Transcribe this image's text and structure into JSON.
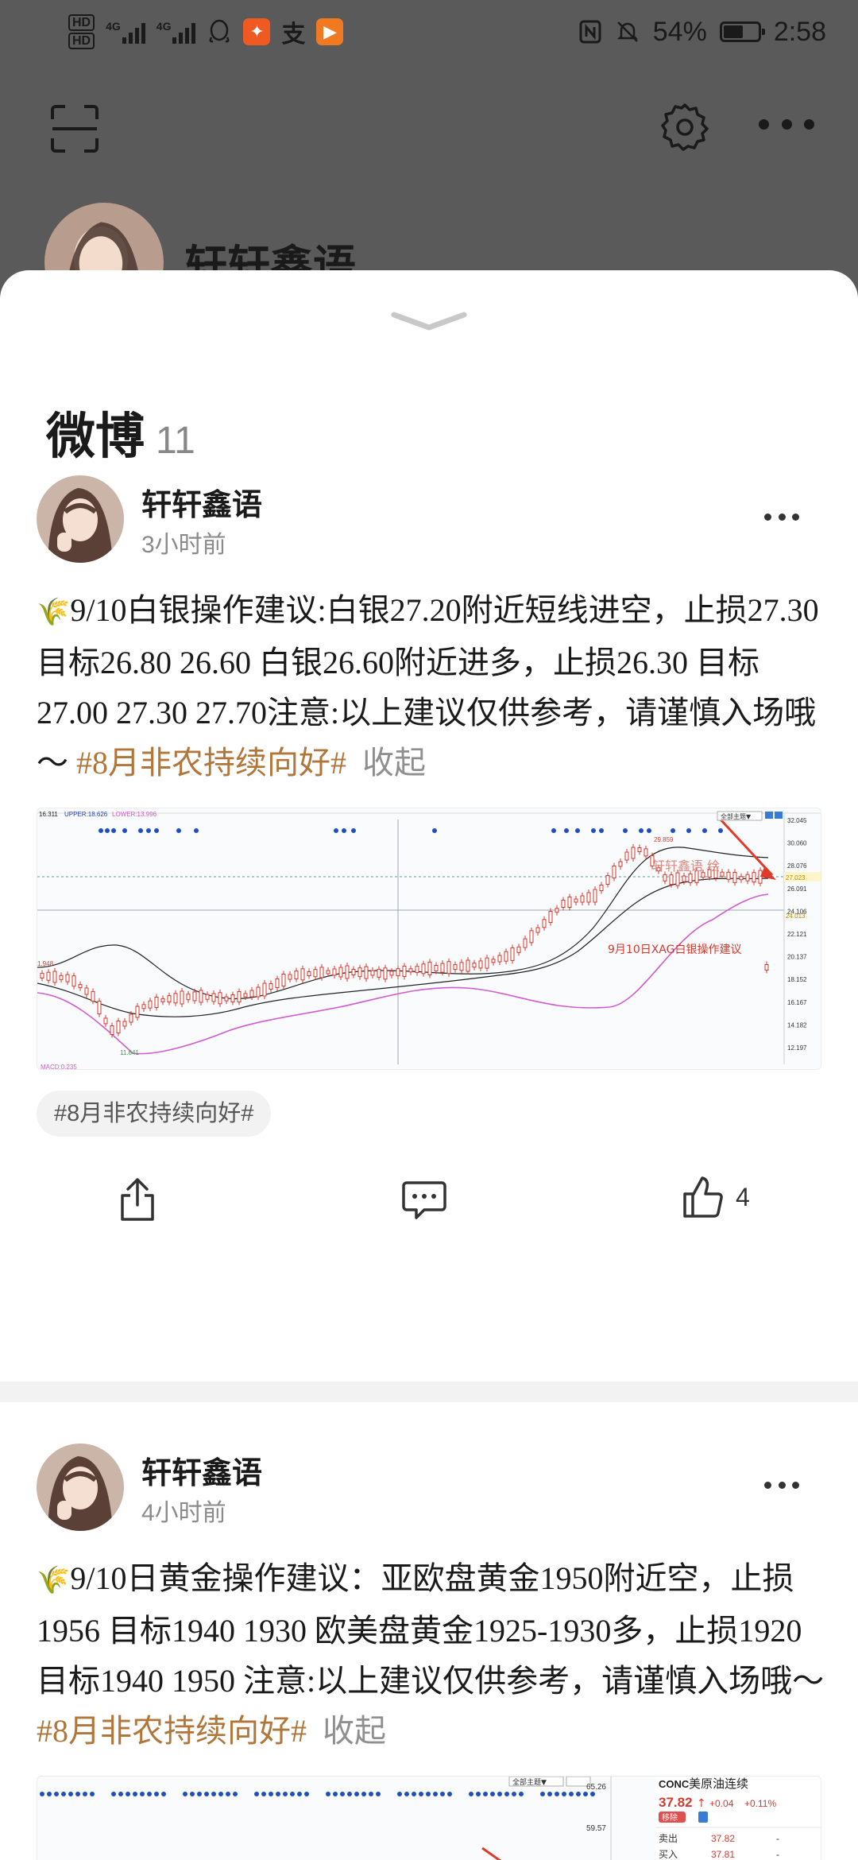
{
  "status_bar": {
    "hd1": "HD",
    "hd2": "HD",
    "sig1": "4G",
    "sig2": "4G",
    "battery_percent": "54%",
    "battery_level": 0.54,
    "time": "2:58",
    "icons": [
      "hd-icon",
      "signal-icon",
      "qq-icon",
      "orange-app-icon",
      "alipay-icon",
      "play-app-icon",
      "nfc-icon",
      "mute-icon",
      "battery-icon"
    ]
  },
  "header": {
    "profile_name": "轩轩鑫语",
    "icons": [
      "scan-icon",
      "gear-icon",
      "more-icon"
    ]
  },
  "sheet": {
    "title": "微博",
    "count": "11"
  },
  "posts": [
    {
      "author": "轩轩鑫语",
      "time": "3小时前",
      "text": "9/10白银操作建议:白银27.20附近短线进空，止损27.30 目标26.80 26.60 白银26.60附近进多，止损26.30 目标27.00 27.30 27.70注意:以上建议仅供参考，请谨慎入场哦～",
      "topic": "#8月非农持续向好#",
      "fold": "收起",
      "chip": "#8月非农持续向好#",
      "likes": "4",
      "chart": {
        "upper_label": "UPPER:18.626",
        "lower_label": "LOWER:13.996",
        "left_value": "16.311",
        "left_mid_label": "1.948",
        "low_label": "11.641",
        "high_label": "29.859",
        "macd_label": "MACD:0.235",
        "watermark": "轩轩鑫语 绘",
        "annotation": "9月10日XAG白银操作建议",
        "button_label": "全部主题▼",
        "y_ticks": [
          "32.045",
          "30.060",
          "28.076",
          "26.091",
          "24.106",
          "22.121",
          "20.137",
          "18.152",
          "16.167",
          "14.182",
          "12.197"
        ],
        "current_price": "27.023",
        "cross_price": "24.013"
      }
    },
    {
      "author": "轩轩鑫语",
      "time": "4小时前",
      "text": "9/10日黄金操作建议：亚欧盘黄金1950附近空，止损1956 目标1940 1930 欧美盘黄金1925-1930多，止损1920 目标1940 1950 注意:以上建议仅供参考，请谨慎入场哦～",
      "topic": "#8月非农持续向好#",
      "fold": "收起",
      "chart": {
        "button_label": "全部主题▼",
        "y1": "65.26",
        "y2": "59.57",
        "quote_code": "CONC",
        "quote_name": "美原油连续",
        "quote_price": "37.82",
        "quote_arrow": "↑",
        "quote_change": "+0.04",
        "quote_pct": "+0.11%",
        "quote_badge": "移除",
        "sell_label": "卖出",
        "sell_value": "37.82",
        "buy_label": "买入",
        "buy_value": "37.81",
        "dash": "-"
      }
    }
  ],
  "colors": {
    "topic": "#b0763a",
    "sheet_bg": "#ffffff",
    "dim_bg": "#5a5a5a",
    "candle_up": "#d63a2e",
    "candle_down": "#3a9a4a",
    "lower_band": "#d25ad2"
  }
}
